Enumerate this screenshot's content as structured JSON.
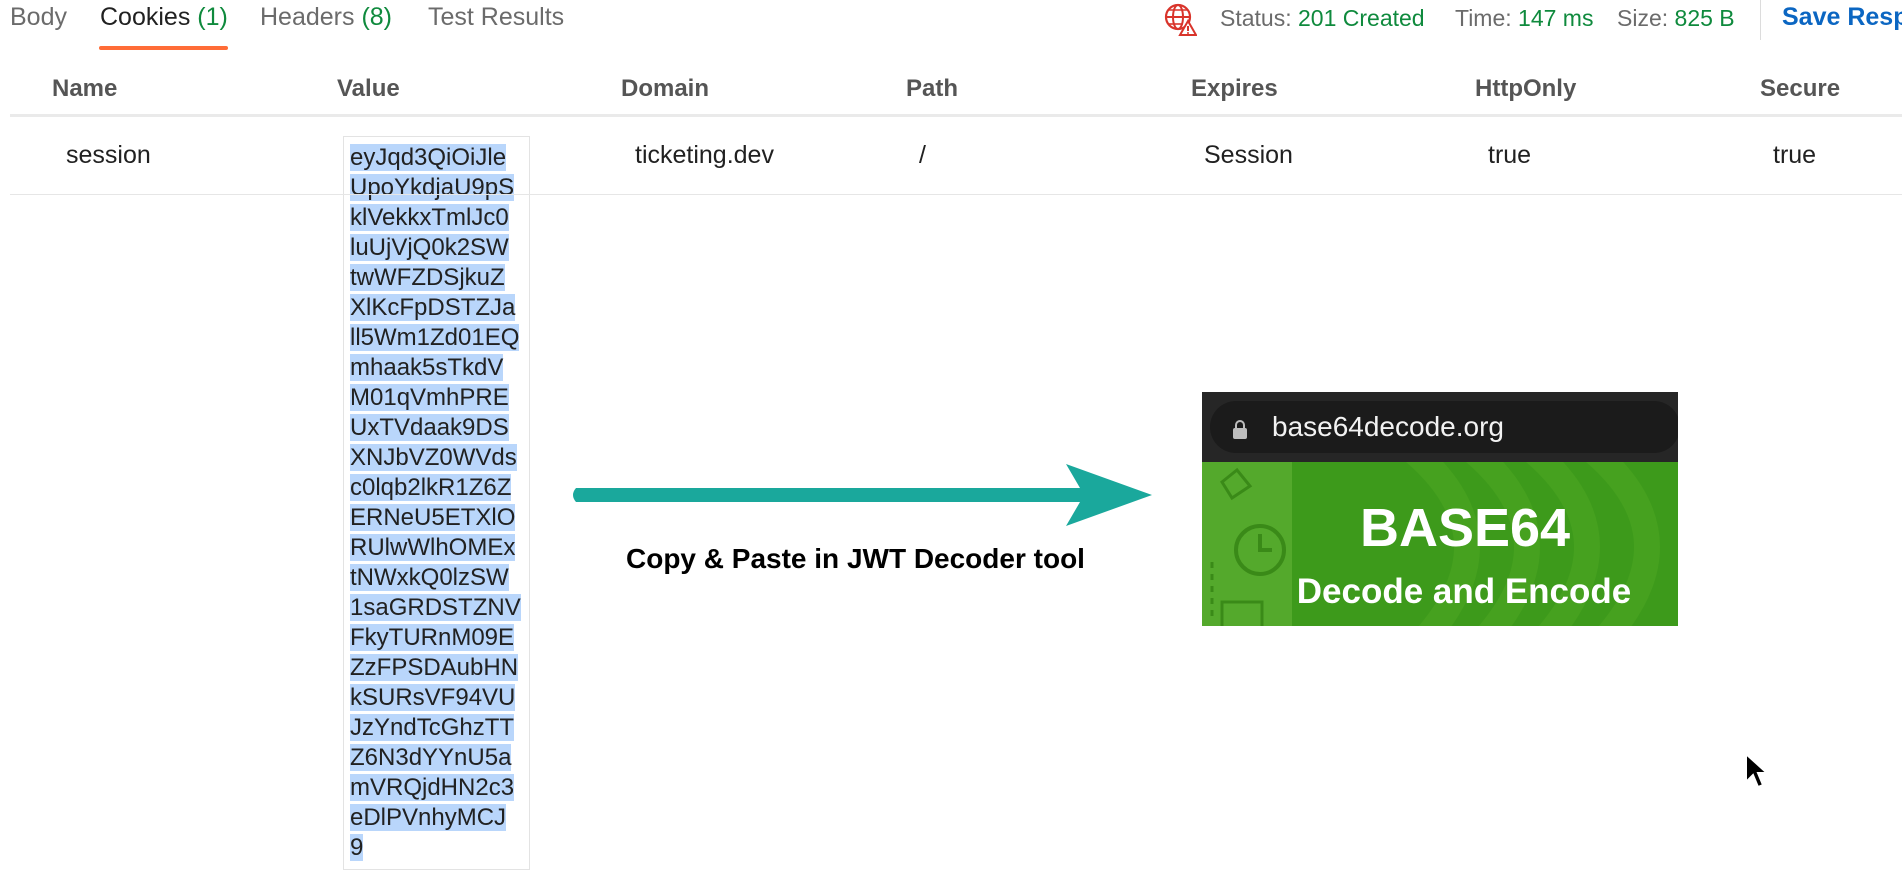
{
  "response_tabs": [
    {
      "label": "Body",
      "count": ""
    },
    {
      "label": "Cookies",
      "count": "(1)"
    },
    {
      "label": "Headers",
      "count": "(8)"
    },
    {
      "label": "Test Results",
      "count": ""
    }
  ],
  "active_tab": "Cookies",
  "status": {
    "label": "Status:",
    "value": "201 Created"
  },
  "time": {
    "label": "Time:",
    "value": "147 ms"
  },
  "size": {
    "label": "Size:",
    "value": "825 B"
  },
  "save_response_label": "Save Resp",
  "cookies_table": {
    "columns": [
      "Name",
      "Value",
      "Domain",
      "Path",
      "Expires",
      "HttpOnly",
      "Secure"
    ],
    "rows": [
      {
        "name": "session",
        "value_lines": [
          "eyJqd3QiOiJle",
          "UpoYkdjaU9pS",
          "klVekkxTmlJc0",
          "luUjVjQ0k2SW",
          "twWFZDSjkuZ",
          "XlKcFpDSTZJa",
          "ll5Wm1Zd01EQ",
          "mhaak5sTkdV",
          "M01qVmhPRE",
          "UxTVdaak9DS",
          "XNJbVZ0WVds",
          "c0lqb2lkR1Z6Z",
          "ERNeU5ETXlO",
          "RUlwWlhOMEx",
          "tNWxkQ0lzSW",
          "1saGRDSTZNV",
          "FkyTURnM09E",
          "ZzFPSDAubHN",
          "kSURsVF94VU",
          "JzYndTcGhzTT",
          "Z6N3dYYnU5a",
          "mVRQjdHN2c3",
          "eDlPVnhyMCJ",
          "9"
        ],
        "domain": "ticketing.dev",
        "path": "/",
        "expires": "Session",
        "http_only": "true",
        "secure": "true"
      }
    ]
  },
  "annotation": {
    "caption": "Copy & Paste in JWT Decoder tool",
    "arrow_color": "#1aa89c"
  },
  "site_preview": {
    "url": "base64decode.org",
    "title": "BASE64",
    "subtitle": "Decode and Encode"
  },
  "colors": {
    "accent": "#ff6c37",
    "success": "#0f8a3d",
    "link": "#0b66c2",
    "selection": "#b9d6fb",
    "site_green": "#3d9a1b"
  }
}
